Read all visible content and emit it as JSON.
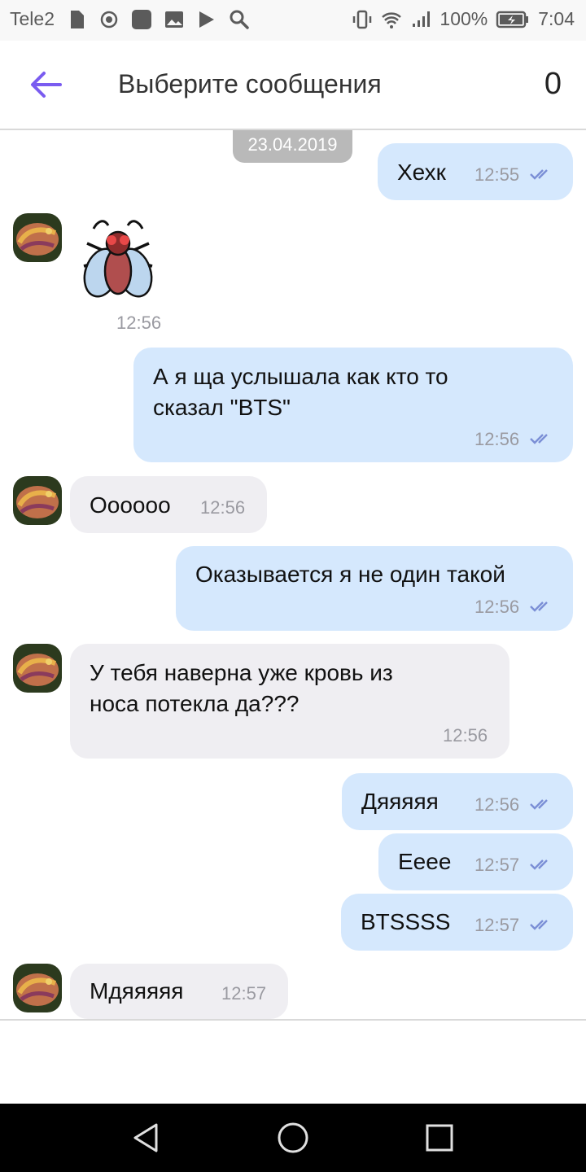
{
  "status_bar": {
    "carrier": "Tele2",
    "battery": "100%",
    "time": "7:04"
  },
  "header": {
    "title": "Выберите сообщения",
    "selected_count": "0"
  },
  "date_separator": "23.04.2019",
  "messages": [
    {
      "direction": "outgoing",
      "text": "Хехк",
      "time": "12:55"
    },
    {
      "direction": "incoming",
      "type": "sticker",
      "sticker": "fly-sticker",
      "time": "12:56"
    },
    {
      "direction": "outgoing",
      "text": "А я ща услышала как кто то\nсказал \"BTS\"",
      "time": "12:56"
    },
    {
      "direction": "incoming",
      "text": "Оооооо",
      "time": "12:56"
    },
    {
      "direction": "outgoing",
      "text": "Оказывается я не один такой",
      "time": "12:56"
    },
    {
      "direction": "incoming",
      "text": "У тебя наверна уже кровь из\nноса потекла да???",
      "time": "12:56"
    },
    {
      "direction": "outgoing",
      "text": "Дяяяяя",
      "time": "12:56"
    },
    {
      "direction": "outgoing",
      "text": "Ееее",
      "time": "12:57"
    },
    {
      "direction": "outgoing",
      "text": "BTSSSS",
      "time": "12:57"
    },
    {
      "direction": "incoming",
      "text": "Мдяяяяя",
      "time": "12:57"
    }
  ],
  "colors": {
    "accent": "#7a5cf0",
    "outgoing_bubble": "#d5e8fd",
    "incoming_bubble": "#efeef2",
    "timestamp": "#9a9aa1"
  },
  "icons": {
    "back": "arrow-left-icon",
    "read_status": "double-check-icon",
    "nav_back": "triangle-back-icon",
    "nav_home": "circle-home-icon",
    "nav_recents": "square-recents-icon"
  }
}
